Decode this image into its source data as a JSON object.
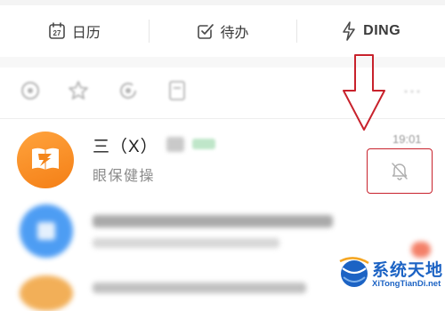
{
  "tabs": [
    {
      "label": "日历",
      "icon": "calendar-icon",
      "icon_text": "27"
    },
    {
      "label": "待办",
      "icon": "checkbox-icon"
    },
    {
      "label": "DING",
      "icon": "lightning-icon"
    }
  ],
  "toolbar": {
    "icons": [
      "circle-icon",
      "star-icon",
      "refresh-icon",
      "bookmark-icon",
      "more-icon"
    ],
    "more_label": "···"
  },
  "chat": {
    "title": "三（X）",
    "subtitle": "眼保健操",
    "time": "19:01",
    "avatar_icon": "book-app-icon",
    "status_icon": "bell-mute-icon"
  },
  "annotation": {
    "arrow_color": "#c8222c",
    "box_color": "#c8222c"
  },
  "watermark": {
    "title": "系统天地",
    "subtitle": "XiTongTianDi.net"
  },
  "colors": {
    "avatar_orange": "#f4861c",
    "avatar_blue": "#2f8cf2",
    "watermark_blue": "#1c63c4"
  }
}
